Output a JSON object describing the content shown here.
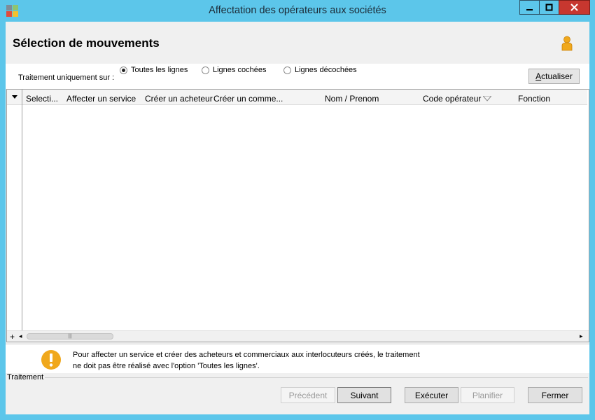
{
  "window": {
    "title": "Affectation des opérateurs aux sociétés",
    "controls": {
      "minimize": "▁",
      "maximize": "□",
      "close": "✕"
    }
  },
  "header": {
    "title": "Sélection de mouvements",
    "user_icon": "user-icon"
  },
  "options": {
    "label": "Traitement uniquement sur :",
    "radios": [
      {
        "label": "Toutes les lignes",
        "selected": true
      },
      {
        "label": "Lignes cochées",
        "selected": false
      },
      {
        "label": "Lignes décochées",
        "selected": false
      }
    ],
    "refresh_button": {
      "accel": "A",
      "rest": "ctualiser"
    }
  },
  "grid": {
    "columns": [
      "Selecti...",
      "Affecter un service",
      "Créer un acheteur",
      "Créer un comme...",
      "Nom / Prenom",
      "Code opérateur",
      "Fonction"
    ],
    "rows": [],
    "add_row_glyph": "+",
    "scroll_left": "◂",
    "scroll_right": "▸",
    "thumb_grip": "|||"
  },
  "info": {
    "icon": "warning-icon",
    "line1": "Pour affecter un service et créer des acheteurs et commerciaux aux interlocuteurs créés, le traitement",
    "line2": "ne doit pas être réalisé avec l'option 'Toutes les lignes'."
  },
  "footer": {
    "section_label": "Traitement",
    "buttons": {
      "previous": "Précédent",
      "next": "Suivant",
      "execute": "Exécuter",
      "schedule": "Planifier",
      "close": "Fermer"
    }
  },
  "colors": {
    "titlebar": "#5cc6ea",
    "close_button": "#c7372f",
    "accent_orange": "#f0a81c"
  }
}
